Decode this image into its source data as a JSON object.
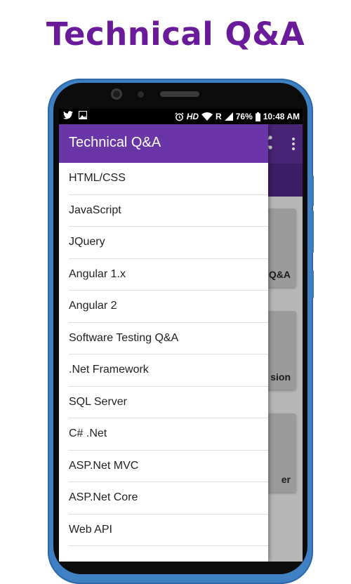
{
  "promo": {
    "title": "Technical Q&A"
  },
  "status_bar": {
    "hd": "HD",
    "roaming": "R",
    "battery": "76%",
    "time": "10:48 AM"
  },
  "drawer": {
    "title": "Technical Q&A",
    "items": [
      {
        "label": "HTML/CSS"
      },
      {
        "label": "JavaScript"
      },
      {
        "label": "JQuery"
      },
      {
        "label": "Angular 1.x"
      },
      {
        "label": "Angular 2"
      },
      {
        "label": "Software Testing Q&A"
      },
      {
        "label": ".Net Framework"
      },
      {
        "label": "SQL Server"
      },
      {
        "label": "C# .Net"
      },
      {
        "label": "ASP.Net MVC"
      },
      {
        "label": "ASP.Net Core"
      },
      {
        "label": "Web API"
      }
    ]
  },
  "background_cards": [
    {
      "text": "Q&A"
    },
    {
      "text": "sion"
    },
    {
      "text": "er"
    }
  ],
  "colors": {
    "promo_title": "#6a1b9a",
    "drawer_header": "#6a35a6",
    "app_bar": "#5b2d91",
    "phone_body": "#3f7fc4"
  }
}
